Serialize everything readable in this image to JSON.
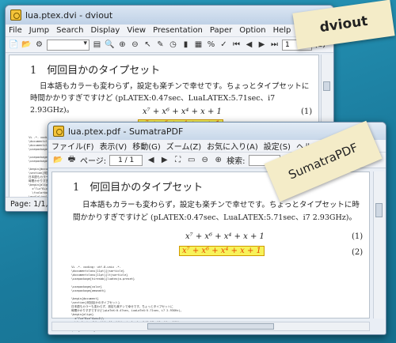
{
  "dviout": {
    "title": "lua.ptex.dvi - dviout",
    "menu": [
      "File",
      "Jump",
      "Search",
      "Display",
      "View",
      "Presentation",
      "Paper",
      "Option",
      "Help"
    ],
    "page_field": "1",
    "page_total": "(1)",
    "status": "Page: 1/1, nun"
  },
  "sumatra": {
    "title": "lua.ptex.pdf - SumatraPDF",
    "menu": [
      "ファイル(F)",
      "表示(V)",
      "移動(G)",
      "ズーム(Z)",
      "お気に入り(A)",
      "設定(S)",
      "ヘルプ(H)"
    ],
    "page_label": "ページ:",
    "page_field": "1 / 1",
    "search_label": "検索:"
  },
  "document": {
    "heading": "1　何回目かのタイプセット",
    "paragraph": "日本語もカラーも変わらず，設定も楽チンで幸せです。ちょっとタイプセットに時間かかりすぎですけど (pLATEX:0.47sec、LuaLATEX:5.71sec、i7 2.93GHz)。",
    "eq1": "x⁷ + x⁶ + x⁴ + x + 1",
    "eq1_num": "(1)",
    "eq2": "x⁷ + x⁶ + x⁴ + x + 1",
    "eq2_num": "(2)"
  },
  "tags": {
    "dviout": "dviout",
    "sumatra": "SumatraPDF"
  },
  "code_lines": [
    "%% -*- coding: utf-8-unix -*-",
    "\\documentclass[11pt]{jsarticle}",
    "\\documentclass[11pt]{ltjsarticle}",
    "\\usepackage[hiresbb]{luatexja-preset}",
    "",
    "\\usepackage{color}",
    "\\usepackage{amsmath}",
    "",
    "\\begin{document}",
    "\\section{何回目かのタイプセット}",
    "日本語もカラーも変わらず，設定も楽チンで幸せです。ちょっとタイプセットに",
    "時間かかりすぎですけど(pLaTeX:0.47sec、LuaLaTeX:5.71sec、i7 2.93GHz)。",
    "\\begin{align}",
    "  x^7+x^6+x^4+x+1\\\\",
    "  \\fcolorbox{black}{yellow}{\\textcolor{red}{$x^7+x^6+x^4+x+1$}}",
    "\\end{align}",
    "\\end{document}",
    "",
    "% Local Variables:",
    "% mode: latex"
  ]
}
